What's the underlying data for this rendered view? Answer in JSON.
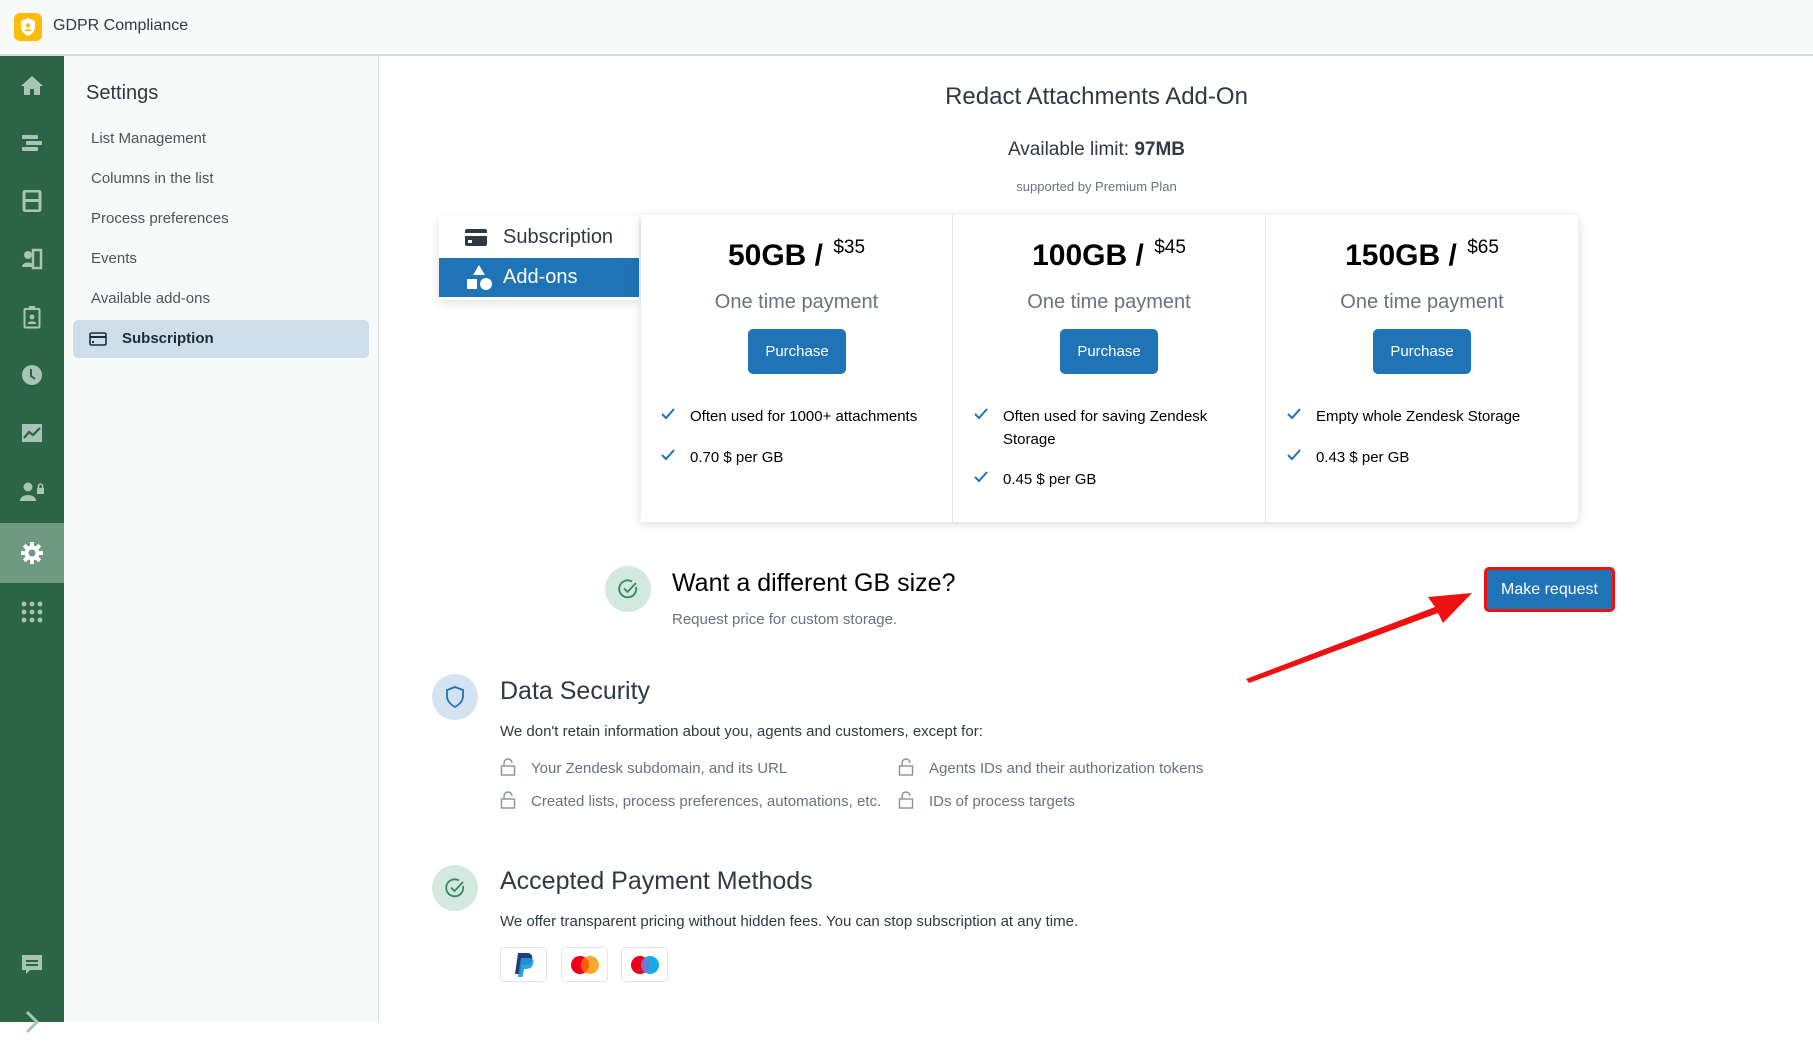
{
  "app": {
    "title": "GDPR Compliance",
    "logo_icon": "shield-user-icon"
  },
  "rail": {
    "items": [
      {
        "icon": "home-icon",
        "active": false
      },
      {
        "icon": "list-icon",
        "active": false
      },
      {
        "icon": "inbox-icon",
        "active": false
      },
      {
        "icon": "contacts-icon",
        "active": false
      },
      {
        "icon": "badge-icon",
        "active": false
      },
      {
        "icon": "clock-icon",
        "active": false
      },
      {
        "icon": "chart-icon",
        "active": false
      },
      {
        "icon": "user-lock-icon",
        "active": false
      },
      {
        "icon": "gear-icon",
        "active": true
      },
      {
        "icon": "apps-grid-icon",
        "active": false
      }
    ],
    "bottom": [
      {
        "icon": "chat-icon"
      },
      {
        "icon": "chevron-right-icon"
      }
    ]
  },
  "settings": {
    "title": "Settings",
    "items": [
      {
        "label": "List Management"
      },
      {
        "label": "Columns in the list"
      },
      {
        "label": "Process preferences"
      },
      {
        "label": "Events"
      },
      {
        "label": "Available add-ons"
      },
      {
        "label": "Subscription",
        "active": true,
        "icon": "credit-card-icon"
      }
    ]
  },
  "main": {
    "title": "Redact Attachments Add-On",
    "limit_label": "Available limit: ",
    "limit_value": "97MB",
    "supported": "supported by Premium Plan",
    "tabs": [
      {
        "label": "Subscription",
        "icon": "credit-card-icon",
        "active": false
      },
      {
        "label": "Add-ons",
        "icon": "shapes-icon",
        "active": true
      }
    ],
    "plans": [
      {
        "size": "50GB",
        "sep": " / ",
        "price": "$35",
        "subtitle": "One time payment",
        "button": "Purchase",
        "features": [
          "Often used for 1000+ attachments",
          "0.70 $ per GB"
        ]
      },
      {
        "size": "100GB",
        "sep": " / ",
        "price": "$45",
        "subtitle": "One time payment",
        "button": "Purchase",
        "features": [
          "Often used for saving Zendesk Storage",
          "0.45 $ per GB"
        ]
      },
      {
        "size": "150GB",
        "sep": " / ",
        "price": "$65",
        "subtitle": "One time payment",
        "button": "Purchase",
        "features": [
          "Empty whole Zendesk Storage",
          "0.43 $ per GB"
        ]
      }
    ],
    "custom": {
      "title": "Want a different GB size?",
      "subtitle": "Request price for custom storage.",
      "button": "Make request"
    },
    "security": {
      "title": "Data Security",
      "text": "We don't retain information about you, agents and customers, except for:",
      "items": [
        "Your Zendesk subdomain, and its URL",
        "Agents IDs and their authorization tokens",
        "Created lists, process preferences, automations, etc.",
        "IDs of process targets"
      ]
    },
    "payment": {
      "title": "Accepted Payment Methods",
      "text": "We offer transparent pricing without hidden fees. You can stop subscription at any time.",
      "methods": [
        "paypal-icon",
        "mastercard-icon",
        "maestro-icon"
      ]
    }
  },
  "colors": {
    "rail": "#2c6446",
    "primary": "#1f73b7",
    "highlight": "#ee1111"
  }
}
